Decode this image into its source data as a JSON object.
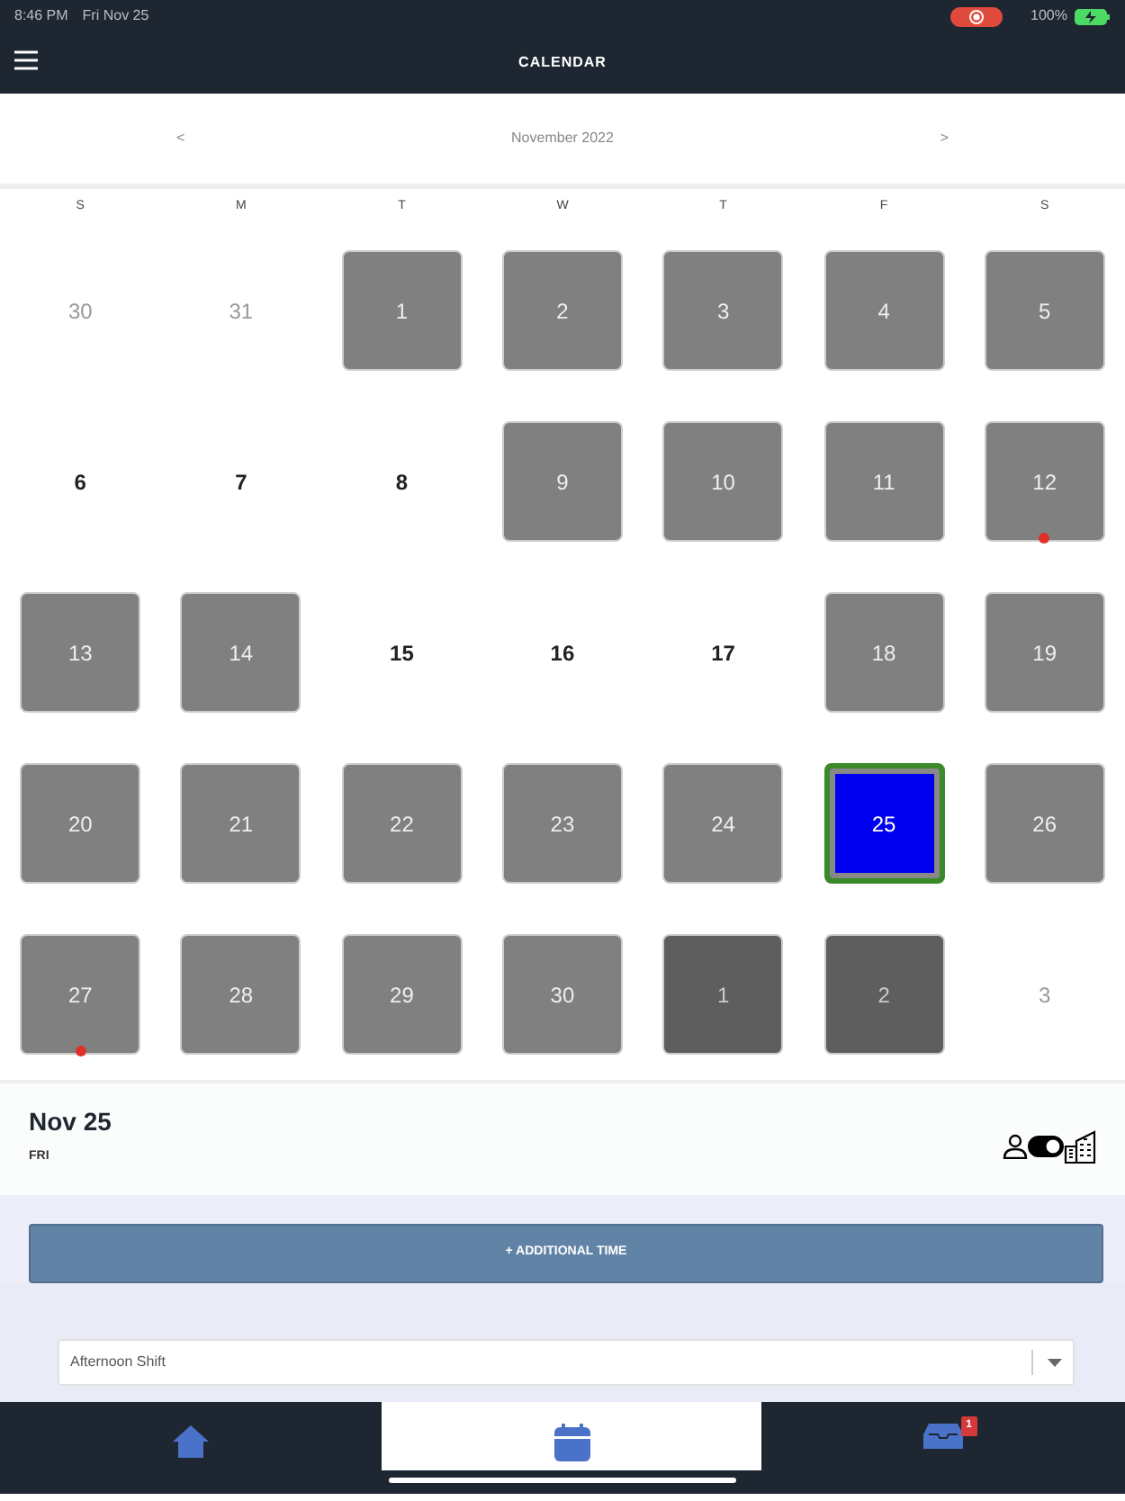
{
  "status_bar": {
    "time": "8:46 PM",
    "date": "Fri Nov 25",
    "battery": "100%"
  },
  "header": {
    "title": "CALENDAR"
  },
  "month_nav": {
    "prev": "<",
    "title": "November 2022",
    "next": ">"
  },
  "weekdays": [
    "S",
    "M",
    "T",
    "W",
    "T",
    "F",
    "S"
  ],
  "weeks": [
    [
      {
        "day": "30",
        "kind": "out",
        "selected": false,
        "dot": false
      },
      {
        "day": "31",
        "kind": "out",
        "selected": false,
        "dot": false
      },
      {
        "day": "1",
        "kind": "tile",
        "selected": false,
        "dot": false
      },
      {
        "day": "2",
        "kind": "tile",
        "selected": false,
        "dot": false
      },
      {
        "day": "3",
        "kind": "tile",
        "selected": false,
        "dot": false
      },
      {
        "day": "4",
        "kind": "tile",
        "selected": false,
        "dot": false
      },
      {
        "day": "5",
        "kind": "tile",
        "selected": false,
        "dot": false
      }
    ],
    [
      {
        "day": "6",
        "kind": "plain",
        "selected": false,
        "dot": false
      },
      {
        "day": "7",
        "kind": "plain",
        "selected": false,
        "dot": false
      },
      {
        "day": "8",
        "kind": "plain",
        "selected": false,
        "dot": false
      },
      {
        "day": "9",
        "kind": "tile",
        "selected": false,
        "dot": false
      },
      {
        "day": "10",
        "kind": "tile",
        "selected": false,
        "dot": false
      },
      {
        "day": "11",
        "kind": "tile",
        "selected": false,
        "dot": false
      },
      {
        "day": "12",
        "kind": "tile",
        "selected": false,
        "dot": true
      }
    ],
    [
      {
        "day": "13",
        "kind": "tile",
        "selected": false,
        "dot": false
      },
      {
        "day": "14",
        "kind": "tile",
        "selected": false,
        "dot": false
      },
      {
        "day": "15",
        "kind": "plain",
        "selected": false,
        "dot": false
      },
      {
        "day": "16",
        "kind": "plain",
        "selected": false,
        "dot": false
      },
      {
        "day": "17",
        "kind": "plain",
        "selected": false,
        "dot": false
      },
      {
        "day": "18",
        "kind": "tile",
        "selected": false,
        "dot": false
      },
      {
        "day": "19",
        "kind": "tile",
        "selected": false,
        "dot": false
      }
    ],
    [
      {
        "day": "20",
        "kind": "tile",
        "selected": false,
        "dot": false
      },
      {
        "day": "21",
        "kind": "tile",
        "selected": false,
        "dot": false
      },
      {
        "day": "22",
        "kind": "tile",
        "selected": false,
        "dot": false
      },
      {
        "day": "23",
        "kind": "tile",
        "selected": false,
        "dot": false
      },
      {
        "day": "24",
        "kind": "tile",
        "selected": false,
        "dot": false
      },
      {
        "day": "25",
        "kind": "tile",
        "selected": true,
        "dot": false
      },
      {
        "day": "26",
        "kind": "tile",
        "selected": false,
        "dot": false
      }
    ],
    [
      {
        "day": "27",
        "kind": "tile",
        "selected": false,
        "dot": true
      },
      {
        "day": "28",
        "kind": "tile",
        "selected": false,
        "dot": false
      },
      {
        "day": "29",
        "kind": "tile",
        "selected": false,
        "dot": false
      },
      {
        "day": "30",
        "kind": "tile",
        "selected": false,
        "dot": false
      },
      {
        "day": "1",
        "kind": "dark",
        "selected": false,
        "dot": false
      },
      {
        "day": "2",
        "kind": "dark",
        "selected": false,
        "dot": false
      },
      {
        "day": "3",
        "kind": "out",
        "selected": false,
        "dot": false
      }
    ]
  ],
  "day_panel": {
    "date": "Nov 25",
    "weekday": "FRI",
    "toggle_on": true
  },
  "additional_time_button": "+ ADDITIONAL TIME",
  "shift_select": {
    "value": "Afternoon Shift"
  },
  "tab_bar": [
    {
      "kind": "home",
      "selected": false
    },
    {
      "kind": "calendar",
      "selected": true
    },
    {
      "kind": "inbox",
      "selected": false,
      "badge": "1"
    }
  ]
}
